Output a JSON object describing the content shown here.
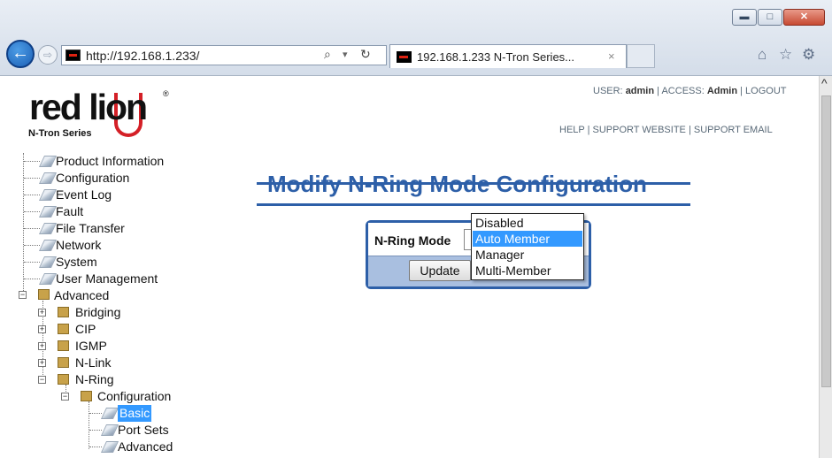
{
  "browser": {
    "address": "http://192.168.1.233/",
    "tab_title": "192.168.1.233 N-Tron Series...",
    "tab_close": "×",
    "search_glyph": "⌕",
    "refresh_glyph": "↻",
    "window_controls": {
      "minimize": "▬",
      "maximize": "□",
      "close": "✕"
    },
    "back_glyph": "←",
    "forward_glyph": "⇨",
    "toolbar_icons": {
      "home": "⌂",
      "favorites": "☆",
      "settings": "⚙"
    }
  },
  "header": {
    "logo_text": "red lion",
    "logo_subtitle": "N-Tron Series",
    "user_prefix": "USER:",
    "user": "admin",
    "access_prefix": "ACCESS:",
    "access": "Admin",
    "logout": "LOGOUT",
    "help": "HELP",
    "support_website": "SUPPORT WEBSITE",
    "support_email": "SUPPORT EMAIL",
    "separator": "|"
  },
  "tree": {
    "product_information": "Product Information",
    "configuration": "Configuration",
    "event_log": "Event Log",
    "fault": "Fault",
    "file_transfer": "File Transfer",
    "network": "Network",
    "system": "System",
    "user_management": "User Management",
    "advanced": "Advanced",
    "bridging": "Bridging",
    "cip": "CIP",
    "igmp": "IGMP",
    "nlink": "N-Link",
    "nring": "N-Ring",
    "nring_configuration": "Configuration",
    "basic": "Basic",
    "port_sets": "Port Sets",
    "advanced_sub": "Advanced",
    "expand": "+",
    "collapse": "−"
  },
  "main": {
    "title": "Modify N-Ring Mode Configuration",
    "field_label": "N-Ring Mode",
    "selected_value": "Auto Member",
    "update_button": "Update",
    "options": [
      "Disabled",
      "Auto Member",
      "Manager",
      "Multi-Member"
    ]
  },
  "scrollbar": {
    "up_glyph": "^"
  },
  "colors": {
    "accent": "#2d5fa8",
    "selection": "#3399ff",
    "brand_red": "#d42027",
    "panel_footer": "#a9bfe0"
  }
}
